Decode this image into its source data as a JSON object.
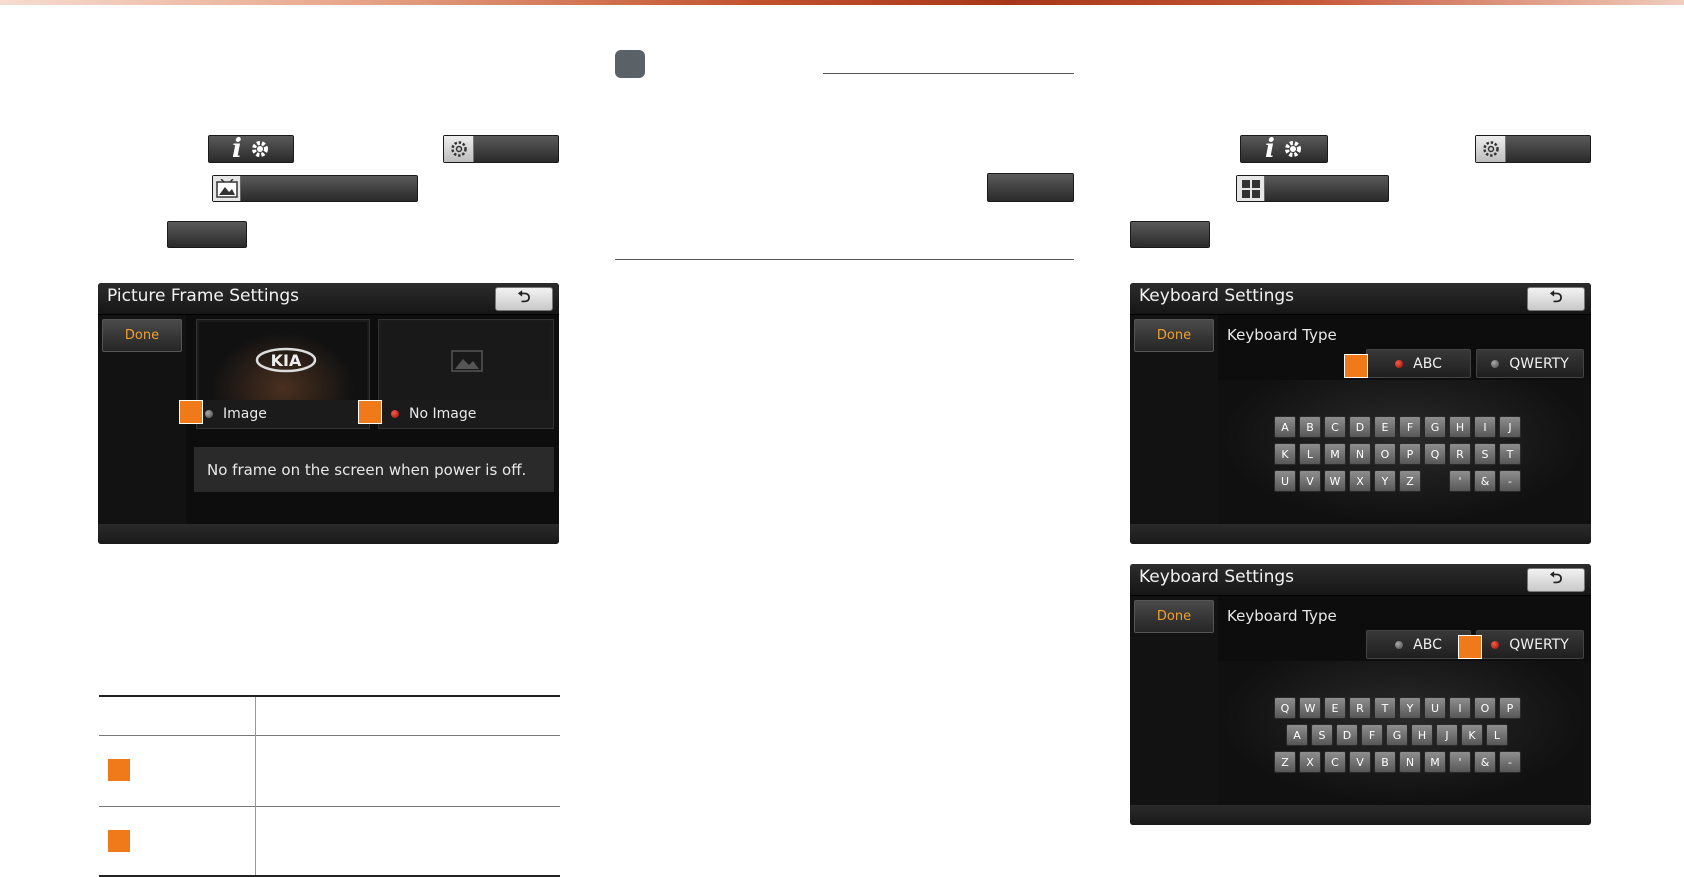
{
  "page": {
    "accent_color": "#c2512d",
    "callout_color": "#f07a1a",
    "badge_color": "#5a6268"
  },
  "left_instructions": {
    "info_button_icons": [
      "info-icon",
      "gear-icon"
    ],
    "settings_button_icon": "gear-icon",
    "picture_frame_button_icon": "picture-frame-icon"
  },
  "middle_section": {
    "badge_icon": "note-badge"
  },
  "right_instructions": {
    "info_button_icons": [
      "info-icon",
      "gear-icon"
    ],
    "settings_button_icon": "gear-icon",
    "keyboard_button_icon": "keyboard-icon"
  },
  "picture_frame_screen": {
    "title": "Picture Frame Settings",
    "done_label": "Done",
    "options": [
      {
        "label": "Image",
        "selected": false,
        "thumbnail": "kia-logo"
      },
      {
        "label": "No Image",
        "selected": true,
        "thumbnail": "landscape-placeholder-icon"
      }
    ],
    "logo_text": "KIA",
    "message": "No frame on the screen when power is off."
  },
  "keyboard_screen_abc": {
    "title": "Keyboard Settings",
    "done_label": "Done",
    "type_label": "Keyboard Type",
    "options": [
      {
        "label": "ABC",
        "selected": true
      },
      {
        "label": "QWERTY",
        "selected": false
      }
    ],
    "rows": [
      [
        "A",
        "B",
        "C",
        "D",
        "E",
        "F",
        "G",
        "H",
        "I",
        "J"
      ],
      [
        "K",
        "L",
        "M",
        "N",
        "O",
        "P",
        "Q",
        "R",
        "S",
        "T"
      ],
      [
        "U",
        "V",
        "W",
        "X",
        "Y",
        "Z",
        "",
        "'",
        "&",
        "-"
      ]
    ]
  },
  "keyboard_screen_qwerty": {
    "title": "Keyboard Settings",
    "done_label": "Done",
    "type_label": "Keyboard Type",
    "options": [
      {
        "label": "ABC",
        "selected": false
      },
      {
        "label": "QWERTY",
        "selected": true
      }
    ],
    "rows": [
      [
        "Q",
        "W",
        "E",
        "R",
        "T",
        "Y",
        "U",
        "I",
        "O",
        "P"
      ],
      [
        "A",
        "S",
        "D",
        "F",
        "G",
        "H",
        "J",
        "K",
        "L"
      ],
      [
        "Z",
        "X",
        "C",
        "V",
        "B",
        "N",
        "M",
        "'",
        "&",
        "-"
      ]
    ]
  },
  "table": {
    "rows": 2
  }
}
